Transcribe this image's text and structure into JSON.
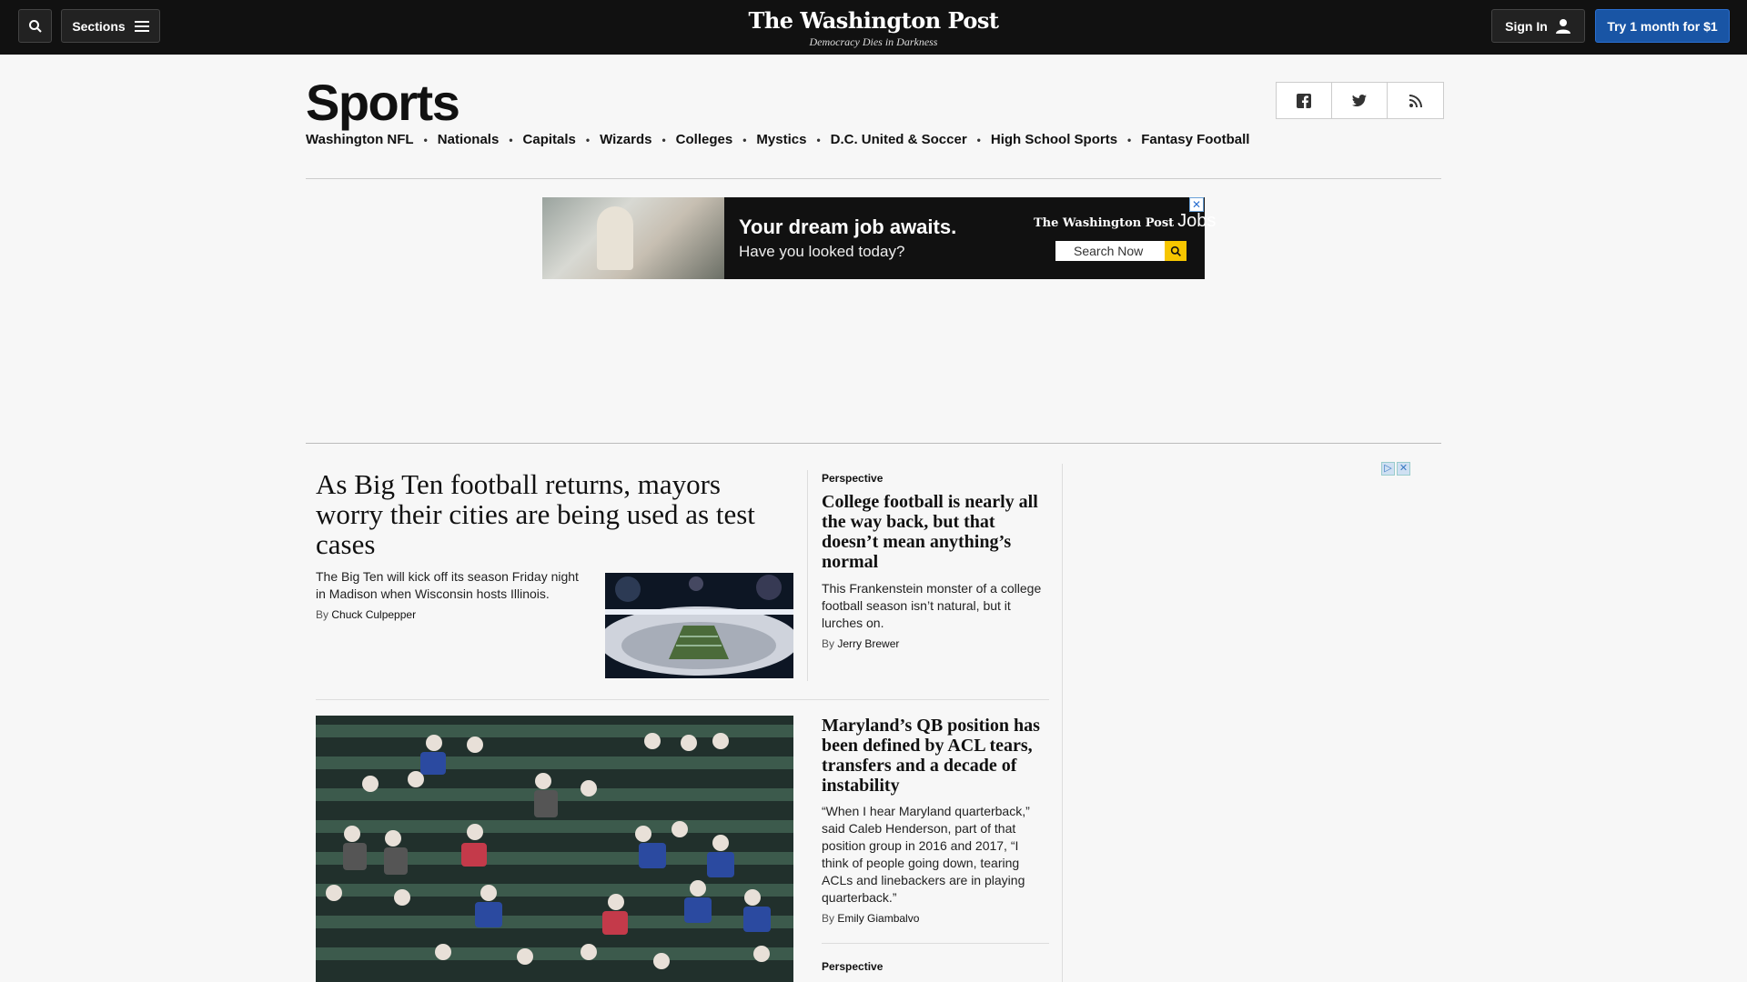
{
  "topbar": {
    "sections_label": "Sections",
    "logo_name": "The Washington Post",
    "logo_tagline": "Democracy Dies in Darkness",
    "signin_label": "Sign In",
    "subscribe_label": "Try 1 month for $1"
  },
  "header": {
    "title": "Sports",
    "subnav": [
      "Washington NFL",
      "Nationals",
      "Capitals",
      "Wizards",
      "Colleges",
      "Mystics",
      "D.C. United & Soccer",
      "High School Sports",
      "Fantasy Football"
    ],
    "social_icons": [
      "facebook-icon",
      "twitter-icon",
      "rss-icon"
    ]
  },
  "ad_banner": {
    "headline": "Your dream job awaits.",
    "subline": "Have you looked today?",
    "brand": "The Washington Post",
    "brand_suffix": "Jobs",
    "search_label": "Search Now"
  },
  "lead_story": {
    "headline": "As Big Ten football returns, mayors worry their cities are being used as test cases",
    "blurb": "The Big Ten will kick off its season Friday night in Madison when Wisconsin hosts Illinois.",
    "by": "By",
    "author": "Chuck Culpepper"
  },
  "side_story_1": {
    "kicker": "Perspective",
    "headline": "College football is nearly all the way back, but that doesn’t mean anything’s normal",
    "blurb": "This Frankenstein monster of a college football season isn’t natural, but it lurches on.",
    "by": "By",
    "author": "Jerry Brewer"
  },
  "side_story_2": {
    "headline": "Maryland’s QB position has been defined by ACL tears, transfers and a decade of instability",
    "blurb": "“When I hear Maryland quarterback,” said Caleb Henderson, part of that position group in 2016 and 2017, “I think of people going down, tearing ACLs and linebackers are in playing quarterback.”",
    "by": "By",
    "author": "Emily Giambalvo"
  },
  "next_story": {
    "kicker": "Perspective"
  },
  "colors": {
    "topbar": "#111111",
    "subscribe": "#1955a5",
    "page_bg": "#f7f7f7"
  }
}
